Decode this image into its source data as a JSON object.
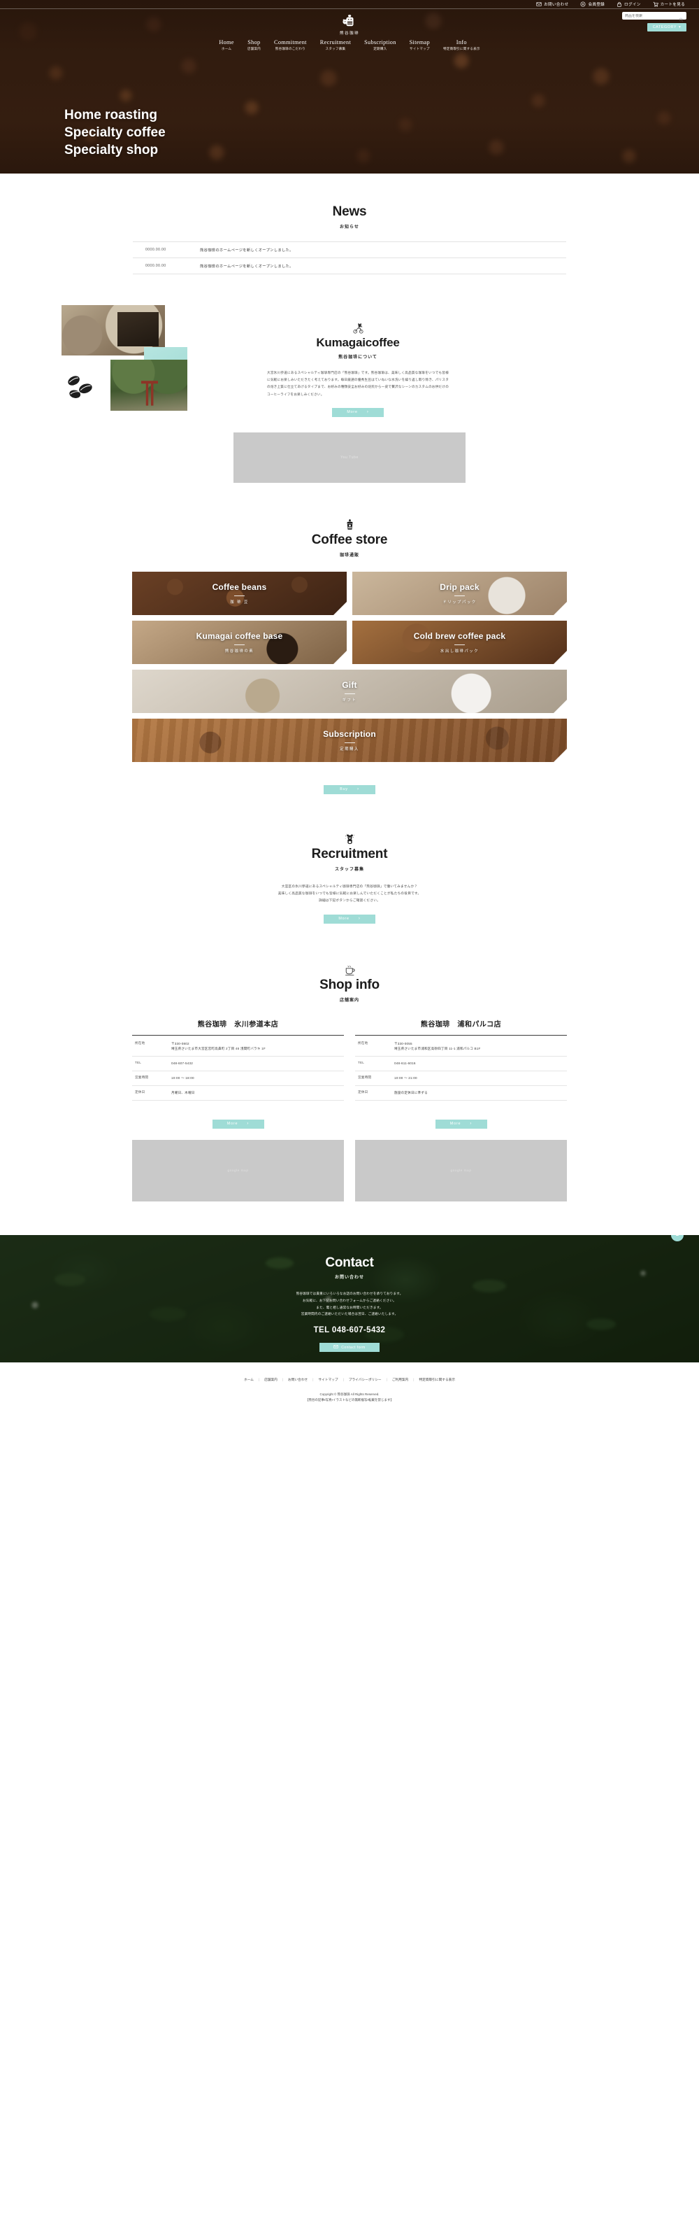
{
  "utility_bar": [
    {
      "label": "お問い合わせ",
      "icon": "mail-icon"
    },
    {
      "label": "会員登録",
      "icon": "user-plus-icon"
    },
    {
      "label": "ログイン",
      "icon": "lock-icon"
    },
    {
      "label": "カートを見る",
      "icon": "cart-icon"
    }
  ],
  "brand": {
    "name": "熊谷珈琲",
    "logo_icon": "bear-coffee-logo-icon"
  },
  "nav": [
    {
      "en": "Home",
      "jp": "ホーム"
    },
    {
      "en": "Shop",
      "jp": "店舗案内"
    },
    {
      "en": "Commitment",
      "jp": "熊谷珈琲のこだわり"
    },
    {
      "en": "Recruitment",
      "jp": "スタッフ募集"
    },
    {
      "en": "Subscription",
      "jp": "定期購入"
    },
    {
      "en": "Sitemap",
      "jp": "サイトマップ"
    },
    {
      "en": "Info",
      "jp": "特定商取引に関する表示"
    }
  ],
  "search": {
    "placeholder": "商品を検索",
    "icon": "search-icon"
  },
  "category_button": {
    "label": "CATEGORY",
    "icon": "chevron-down-icon"
  },
  "hero": {
    "line1": "Home roasting",
    "line2": "Specialty coffee",
    "line3": "Specialty shop"
  },
  "news": {
    "title": "News",
    "subtitle": "お知らせ",
    "items": [
      {
        "date": "0000.00.00",
        "text": "熊谷珈琲のホームページを新しくオープンしました。"
      },
      {
        "date": "0000.00.00",
        "text": "熊谷珈琲のホームページを新しくオープンしました。"
      }
    ]
  },
  "about": {
    "icon": "bear-on-bicycle-icon",
    "title": "Kumagaicoffee",
    "subtitle": "熊谷珈琲について",
    "body": "大宮氷川参道にあるスペシャルティ珈琲専門店の「熊谷珈琲」です。熊谷珈琲は、美味しく高品質な珈琲をいつでも皆様に気軽にお楽しみいただきたく考えております。毎日厳選の優秀生豆はていねいな水洗いを繰り返し取り除き、パリスタの焙き上質に仕立てあげるタイプまで、お好みの種類安全お好みの焙煎から一皮で贅沢なシーンのカスタムのお供だけのコーヒーライフをお楽しみください。",
    "more_button": "More"
  },
  "video": {
    "placeholder": "You Tube"
  },
  "store": {
    "icon": "coffee-mill-icon",
    "title": "Coffee store",
    "subtitle": "珈琲通販",
    "cards": [
      {
        "en": "Coffee beans",
        "jp": "珈 琲 豆"
      },
      {
        "en": "Drip pack",
        "jp": "ドリップパック"
      },
      {
        "en": "Kumagai coffee base",
        "jp": "熊谷珈琲の素"
      },
      {
        "en": "Cold brew coffee pack",
        "jp": "水出し珈琲パック"
      },
      {
        "en": "Gift",
        "jp": "ギフト"
      },
      {
        "en": "Subscription",
        "jp": "定期購入"
      }
    ],
    "buy_button": "Buy"
  },
  "recruit": {
    "icon": "bear-sitting-icon",
    "title": "Recruitment",
    "subtitle": "スタッフ募集",
    "body_line1": "大宮区の氷川参道にあるスペシャルティ珈琲専門店の「熊谷珈琲」で働いてみませんか？",
    "body_line2": "美味しく高品質な珈琲をいつでも皆様に気軽にお楽しんでいただくことが私たちの役目です。",
    "body_line3": "詳細は下記ボタンからご確認ください。",
    "more_button": "More"
  },
  "shopinfo": {
    "icon": "coffee-cup-icon",
    "title": "Shop info",
    "subtitle": "店舗案内",
    "more_button": "More",
    "map_placeholder": "google map",
    "labels": {
      "address": "所在地",
      "tel": "TEL",
      "hours": "営業時間",
      "closed": "定休日"
    },
    "shops": [
      {
        "name": "熊谷珈琲　氷川参道本店",
        "address_zip": "〒330-0802",
        "address_line": "埼玉県さいたま市大宮区宮町高鼻町 2丁目 46 浅間町バラキ 1F",
        "tel": "048-607-5432",
        "hours": "10:00 ～ 18:00",
        "closed": "月曜日、木曜日"
      },
      {
        "name": "熊谷珈琲　浦和パルコ店",
        "address_zip": "〒330-0055",
        "address_line": "埼玉県さいたま市浦和区高砂四丁目 11-1 浦和パルコ B1F",
        "tel": "048-611-6016",
        "hours": "10:00 ～ 21:00",
        "closed": "施設の定休日に準ずる"
      }
    ]
  },
  "contact": {
    "title": "Contact",
    "subtitle": "お問い合わせ",
    "body_line1": "熊谷珈琲では貴重にいろいろなお話のお問い合わせを承りております。",
    "body_line2": "お気軽に、お下記お問い合わせフォームからご連絡ください。",
    "body_line3": "また、電と相し通常なお時間いただきます。",
    "body_line4": "営業時間内のご連絡いただいた場合は翌日、ご連絡いたします。",
    "tel": "TEL 048-607-5432",
    "button": "Contact form",
    "button_icon": "mail-icon",
    "scroll_top_icon": "chevron-up-icon"
  },
  "footer": {
    "links": [
      "ホーム",
      "店舗案内",
      "お問い合わせ",
      "サイトマップ",
      "プライバシーポリシー",
      "ご利用案内",
      "特定商取引に関する表示"
    ],
    "copyright": "Copyright © 熊谷珈琲 All Rights Reserved.",
    "note": "【熊谷の記事・写真・イラストなどの無断複写・転載を禁じます】"
  }
}
